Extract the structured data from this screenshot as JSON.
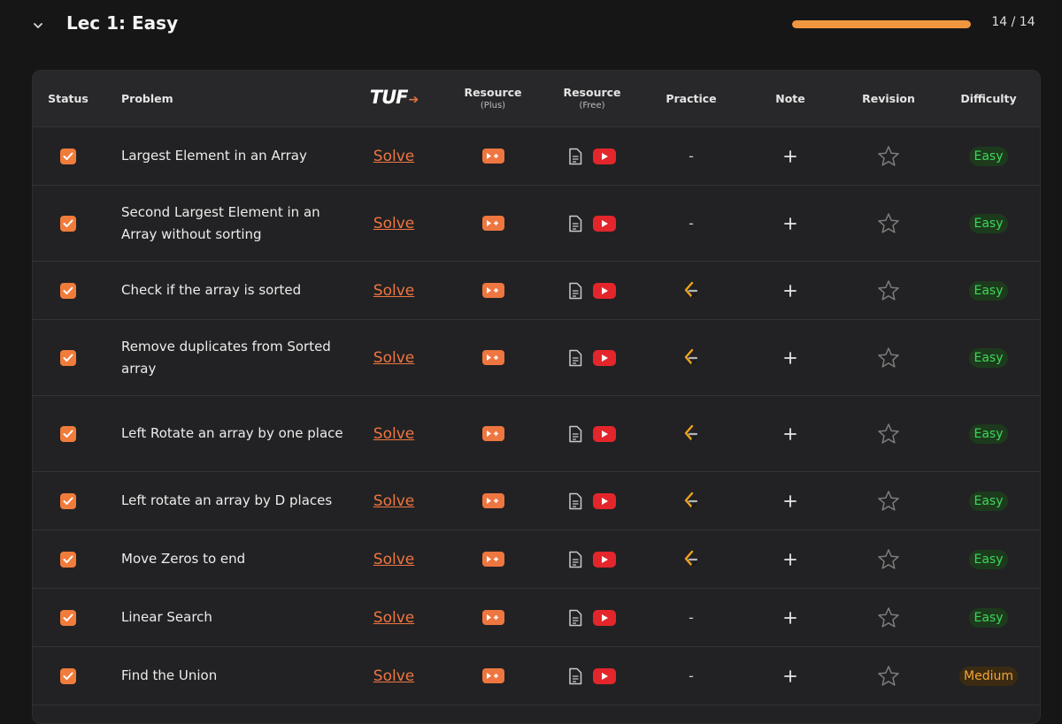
{
  "section": {
    "title": "Lec 1: Easy",
    "progress_fraction": 1.0,
    "progress_text": "14 / 14"
  },
  "headers": {
    "status": "Status",
    "problem": "Problem",
    "tuf_logo": "TUF",
    "resource_plus": "Resource",
    "resource_plus_sub": "(Plus)",
    "resource_free": "Resource",
    "resource_free_sub": "(Free)",
    "practice": "Practice",
    "note": "Note",
    "revision": "Revision",
    "difficulty": "Difficulty"
  },
  "colors": {
    "accent": "#ee7640",
    "easy": "#3fd65a",
    "medium": "#f4a534",
    "youtube": "#e3262b"
  },
  "rows": [
    {
      "problem": "Largest Element in an Array",
      "solve": "Solve",
      "practice": "dash",
      "practice_text": "-",
      "difficulty": "Easy",
      "level": "easy"
    },
    {
      "problem": "Second Largest Element in an Array without sorting",
      "solve": "Solve",
      "practice": "dash",
      "practice_text": "-",
      "difficulty": "Easy",
      "level": "easy"
    },
    {
      "problem": "Check if the array is sorted",
      "solve": "Solve",
      "practice": "leetcode",
      "practice_text": "",
      "difficulty": "Easy",
      "level": "easy"
    },
    {
      "problem": "Remove duplicates from Sorted array",
      "solve": "Solve",
      "practice": "leetcode",
      "practice_text": "",
      "difficulty": "Easy",
      "level": "easy"
    },
    {
      "problem": "Left Rotate an array by one place",
      "solve": "Solve",
      "practice": "leetcode",
      "practice_text": "",
      "difficulty": "Easy",
      "level": "easy"
    },
    {
      "problem": "Left rotate an array by D places",
      "solve": "Solve",
      "practice": "leetcode",
      "practice_text": "",
      "difficulty": "Easy",
      "level": "easy"
    },
    {
      "problem": "Move Zeros to end",
      "solve": "Solve",
      "practice": "leetcode",
      "practice_text": "",
      "difficulty": "Easy",
      "level": "easy"
    },
    {
      "problem": "Linear Search",
      "solve": "Solve",
      "practice": "dash",
      "practice_text": "-",
      "difficulty": "Easy",
      "level": "easy"
    },
    {
      "problem": "Find the Union",
      "solve": "Solve",
      "practice": "dash",
      "practice_text": "-",
      "difficulty": "Medium",
      "level": "medium"
    }
  ]
}
